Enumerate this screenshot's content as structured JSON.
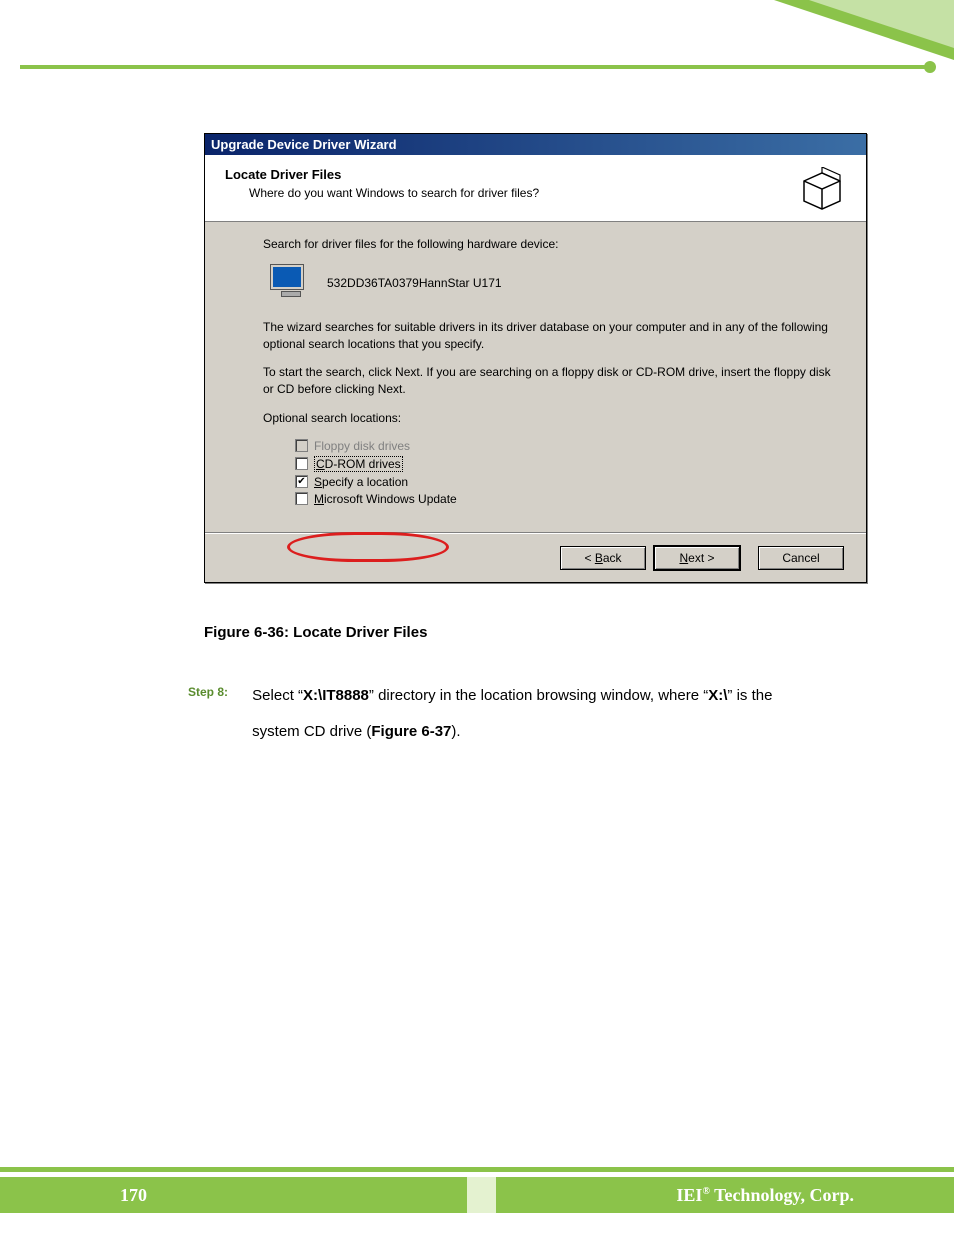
{
  "header": {
    "corner": true
  },
  "wizard": {
    "title": "Upgrade Device Driver Wizard",
    "heading": "Locate Driver Files",
    "subheading": "Where do you want Windows to search for driver files?",
    "searchPrompt": "Search for driver files for the following hardware device:",
    "deviceName": "532DD36TA0379HannStar U171",
    "paragraph1": "The wizard searches for suitable drivers in its driver database on your computer and in any of the following optional search locations that you specify.",
    "paragraph2": "To start the search, click Next. If you are searching on a floppy disk or CD-ROM drive, insert the floppy disk or CD before clicking Next.",
    "optionsLabel": "Optional search locations:",
    "options": {
      "floppy": "Floppy disk drives",
      "cdrom_prefix": "C",
      "cdrom_rest": "D-ROM drives",
      "specify_prefix": "S",
      "specify_rest": "pecify a location",
      "msupdate_prefix": "M",
      "msupdate_rest": "icrosoft Windows Update"
    },
    "buttons": {
      "back_prefix": "< ",
      "back_u": "B",
      "back_rest": "ack",
      "next_u": "N",
      "next_rest": "ext >",
      "cancel": "Cancel"
    }
  },
  "caption": "Figure 6-36: Locate Driver Files",
  "step": {
    "label": "Step 8:",
    "text_1": "Select “",
    "text_bold1": "X:\\IT8888",
    "text_2": "” directory in the location browsing window, where “",
    "text_bold2": "X:\\",
    "text_3": "” is the system CD drive (",
    "text_bold3": "Figure 6-37",
    "text_4": ")."
  },
  "footer": {
    "pageNumber": "170",
    "company_prefix": "IEI",
    "company_reg": "®",
    "company_rest": " Technology, Corp."
  }
}
